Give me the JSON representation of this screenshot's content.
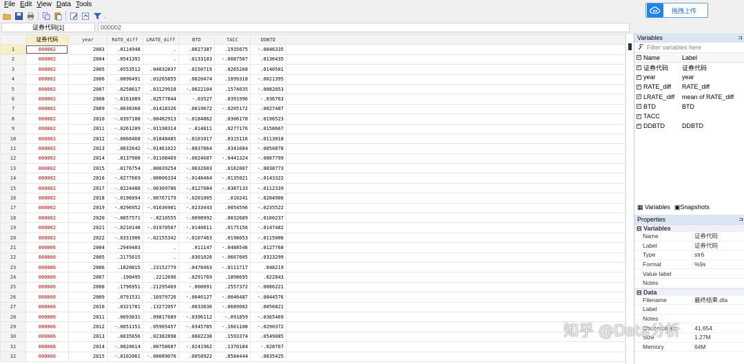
{
  "menu": [
    "File",
    "Edit",
    "View",
    "Data",
    "Tools"
  ],
  "menu_access": [
    "F",
    "E",
    "V",
    "D",
    "T"
  ],
  "upload_button_label": "拖拽上传",
  "cell_ref": "证券代码[1]",
  "cell_value": "000002",
  "columns": [
    "证券代码",
    "year",
    "RATE_diff",
    "LRATE_diff",
    "BTD",
    "TACC",
    "DDBTD"
  ],
  "rows": [
    [
      "1",
      "000002",
      "2003",
      ".0114948",
      ".",
      ".0027387",
      ".1935675",
      "-.0046335"
    ],
    [
      "2",
      "000002",
      "2004",
      ".0541391",
      ".",
      ".0133103",
      "-.0087507",
      ".0136435"
    ],
    [
      "3",
      "000002",
      "2005",
      ".0553512",
      ".04032837",
      ".0150719",
      ".0265268",
      ".0140501"
    ],
    [
      "4",
      "000002",
      "2006",
      ".0096491",
      ".03265855",
      ".0020474",
      ".1099318",
      "-.0021395"
    ],
    [
      "5",
      "000002",
      "2007",
      ".0258617",
      ".03129918",
      "-.0022104",
      ".1574035",
      "-.0082053"
    ],
    [
      "6",
      "000002",
      "2008",
      "-.0161089",
      ".02577844",
      "-.03527",
      ".0391996",
      "-.036763"
    ],
    [
      "7",
      "000002",
      "2009",
      "-.0038368",
      ".01418326",
      ".0019672",
      "-.0205172",
      ".0027487"
    ],
    [
      "8",
      "000002",
      "2010",
      "-.0397108",
      "-.00482913",
      "-.0184862",
      ".0306178",
      "-.0196523"
    ],
    [
      "9",
      "000002",
      "2011",
      "-.0261209",
      "-.01198314",
      "-.014811",
      ".0277176",
      "-.0158667"
    ],
    [
      "10",
      "000002",
      "2012",
      "-.0066468",
      "-.01848485",
      "-.0101017",
      ".0315116",
      "-.0113018"
    ],
    [
      "11",
      "000002",
      "2013",
      ".0032642",
      "-.01461022",
      "-.0037864",
      ".0341684",
      "-.0050878"
    ],
    [
      "12",
      "000002",
      "2014",
      ".0137908",
      "-.01108469",
      "-.0024607",
      "-.0441324",
      "-.0007799"
    ],
    [
      "13",
      "000002",
      "2015",
      ".0176754",
      ".00039254",
      "-.0032603",
      ".0162007",
      "-.0038773"
    ],
    [
      "14",
      "000002",
      "2016",
      "-.0277669",
      ".00006334",
      "-.0148464",
      "-.0135021",
      "-.0143322"
    ],
    [
      "15",
      "000002",
      "2017",
      "-.0224488",
      "-.00309706",
      "-.0127084",
      "-.0387133",
      "-.0112339"
    ],
    [
      "16",
      "000002",
      "2018",
      "-.0196094",
      "-.00767179",
      "-.0201005",
      ".010241",
      "-.0204906"
    ],
    [
      "17",
      "000002",
      "2019",
      "-.0296952",
      "-.01636901",
      "-.0233443",
      ".0054596",
      "-.0235522"
    ],
    [
      "18",
      "000002",
      "2020",
      "-.0057571",
      "-.0210555",
      "-.0098992",
      ".0032689",
      "-.0100237"
    ],
    [
      "19",
      "000002",
      "2021",
      "-.0210148",
      "-.01970507",
      "-.0140811",
      ".0175156",
      "-.0147482"
    ],
    [
      "20",
      "000002",
      "2022",
      "-.0331906",
      "-.02155342",
      "-.0107463",
      ".0198053",
      "-.0115006"
    ],
    [
      "21",
      "000006",
      "2004",
      ".2949403",
      ".",
      ".011147",
      "-.0488546",
      ".0127768"
    ],
    [
      "22",
      "000006",
      "2005",
      ".2175615",
      ".",
      ".0301028",
      "-.0667605",
      ".0323299"
    ],
    [
      "23",
      "000006",
      "2006",
      ".1820815",
      ".23152779",
      ".0478463",
      "-.0111717",
      ".048219"
    ],
    [
      "24",
      "000006",
      "2007",
      ".190495",
      ".2212696",
      ".0291769",
      ".1898695",
      ".022843"
    ],
    [
      "25",
      "000006",
      "2008",
      ".1796951",
      ".21295469",
      "-.000091",
      ".2557372",
      "-.0086221"
    ],
    [
      "26",
      "000006",
      "2009",
      ".0791531",
      ".16979726",
      "-.0046127",
      "-.0046487",
      "-.0044576"
    ],
    [
      "27",
      "000006",
      "2010",
      ".0321781",
      ".13272057",
      ".0033836",
      "-.0689002",
      ".0056821"
    ],
    [
      "28",
      "000006",
      "2011",
      ".0093631",
      ".09817689",
      "-.0396112",
      "-.091859",
      "-.0365469"
    ],
    [
      "29",
      "000006",
      "2012",
      "-.0051151",
      ".05905457",
      "-.0345785",
      "-.1661108",
      "-.0290372"
    ],
    [
      "30",
      "000006",
      "2013",
      ".0035656",
      ".02382898",
      ".0602238",
      ".1593374",
      ".0549085"
    ],
    [
      "31",
      "000006",
      "2014",
      "-.0020614",
      ".00758607",
      "-.0241962",
      ".1370184",
      "-.028767"
    ],
    [
      "32",
      "000006",
      "2015",
      "-.0102061",
      "-.00089076",
      ".0058922",
      ".0584444",
      ".0035425"
    ]
  ],
  "variables_panel": {
    "title": "Variables",
    "filter_placeholder": "Filter variables here",
    "head_name": "Name",
    "head_label": "Label",
    "items": [
      {
        "name": "证券代码",
        "label": "证券代码"
      },
      {
        "name": "year",
        "label": "year"
      },
      {
        "name": "RATE_diff",
        "label": "RATE_diff"
      },
      {
        "name": "LRATE_diff",
        "label": "mean of RATE_diff"
      },
      {
        "name": "BTD",
        "label": "BTD"
      },
      {
        "name": "TACC",
        "label": ""
      },
      {
        "name": "DDBTD",
        "label": "DDBTD"
      }
    ]
  },
  "tabs": {
    "variables": "Variables",
    "snapshots": "Snapshots"
  },
  "properties_panel": {
    "title": "Properties",
    "var_section": "Variables",
    "var_props": [
      {
        "k": "Name",
        "v": "证券代码"
      },
      {
        "k": "Label",
        "v": "证券代码"
      },
      {
        "k": "Type",
        "v": "str6"
      },
      {
        "k": "Format",
        "v": "%9s"
      },
      {
        "k": "Value label",
        "v": ""
      },
      {
        "k": "Notes",
        "v": ""
      }
    ],
    "data_section": "Data",
    "data_props": [
      {
        "k": "Filename",
        "v": "最终结果.dta"
      },
      {
        "k": "Label",
        "v": ""
      },
      {
        "k": "Notes",
        "v": ""
      },
      {
        "k": "Observations",
        "v": "41,654"
      },
      {
        "k": "Size",
        "v": "1.27M"
      },
      {
        "k": "Memory",
        "v": "64M"
      }
    ]
  },
  "watermark": "知乎 @Data分析"
}
